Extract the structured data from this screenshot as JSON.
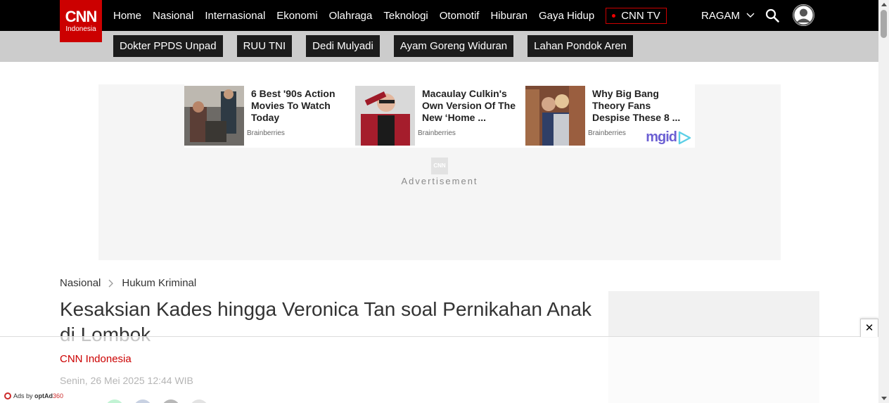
{
  "logo": {
    "mark": "CNN",
    "sub": "Indonesia"
  },
  "nav": {
    "items": [
      "Home",
      "Nasional",
      "Internasional",
      "Ekonomi",
      "Olahraga",
      "Teknologi",
      "Otomotif",
      "Hiburan",
      "Gaya Hidup"
    ],
    "tv_label": "CNN TV",
    "ragam_label": "RAGAM"
  },
  "trending": [
    "Dokter PPDS Unpad",
    "RUU TNI",
    "Dedi Mulyadi",
    "Ayam Goreng Widuran",
    "Lahan Pondok Aren"
  ],
  "ads": {
    "cards": [
      {
        "title": "6 Best '90s Action Movies To Watch Today",
        "source": "Brainberries"
      },
      {
        "title": "Macaulay Culkin's Own Version Of The New ‘Home ...",
        "source": "Brainberries"
      },
      {
        "title": "Why Big Bang Theory Fans Despise These 8 ...",
        "source": "Brainberries"
      }
    ],
    "network_logo": "mgid",
    "placeholder_logo": "CNN",
    "label": "Advertisement"
  },
  "article": {
    "breadcrumb": [
      "Nasional",
      "Hukum Kriminal"
    ],
    "title": "Kesaksian Kades hingga Veronica Tan soal Pernikahan Anak di Lombok",
    "author": "CNN Indonesia",
    "date": "Senin, 26 Mei 2025 12:44 WIB"
  },
  "sticky_ad": {
    "credit_prefix": "Ads by",
    "credit_brand": "optAd",
    "credit_num": "360",
    "close_symbol": "✕"
  },
  "colors": {
    "brand_red": "#cc0000",
    "nav_bg": "#000000",
    "trending_bg": "#cccccc",
    "tag_bg": "#1c1c1c"
  }
}
